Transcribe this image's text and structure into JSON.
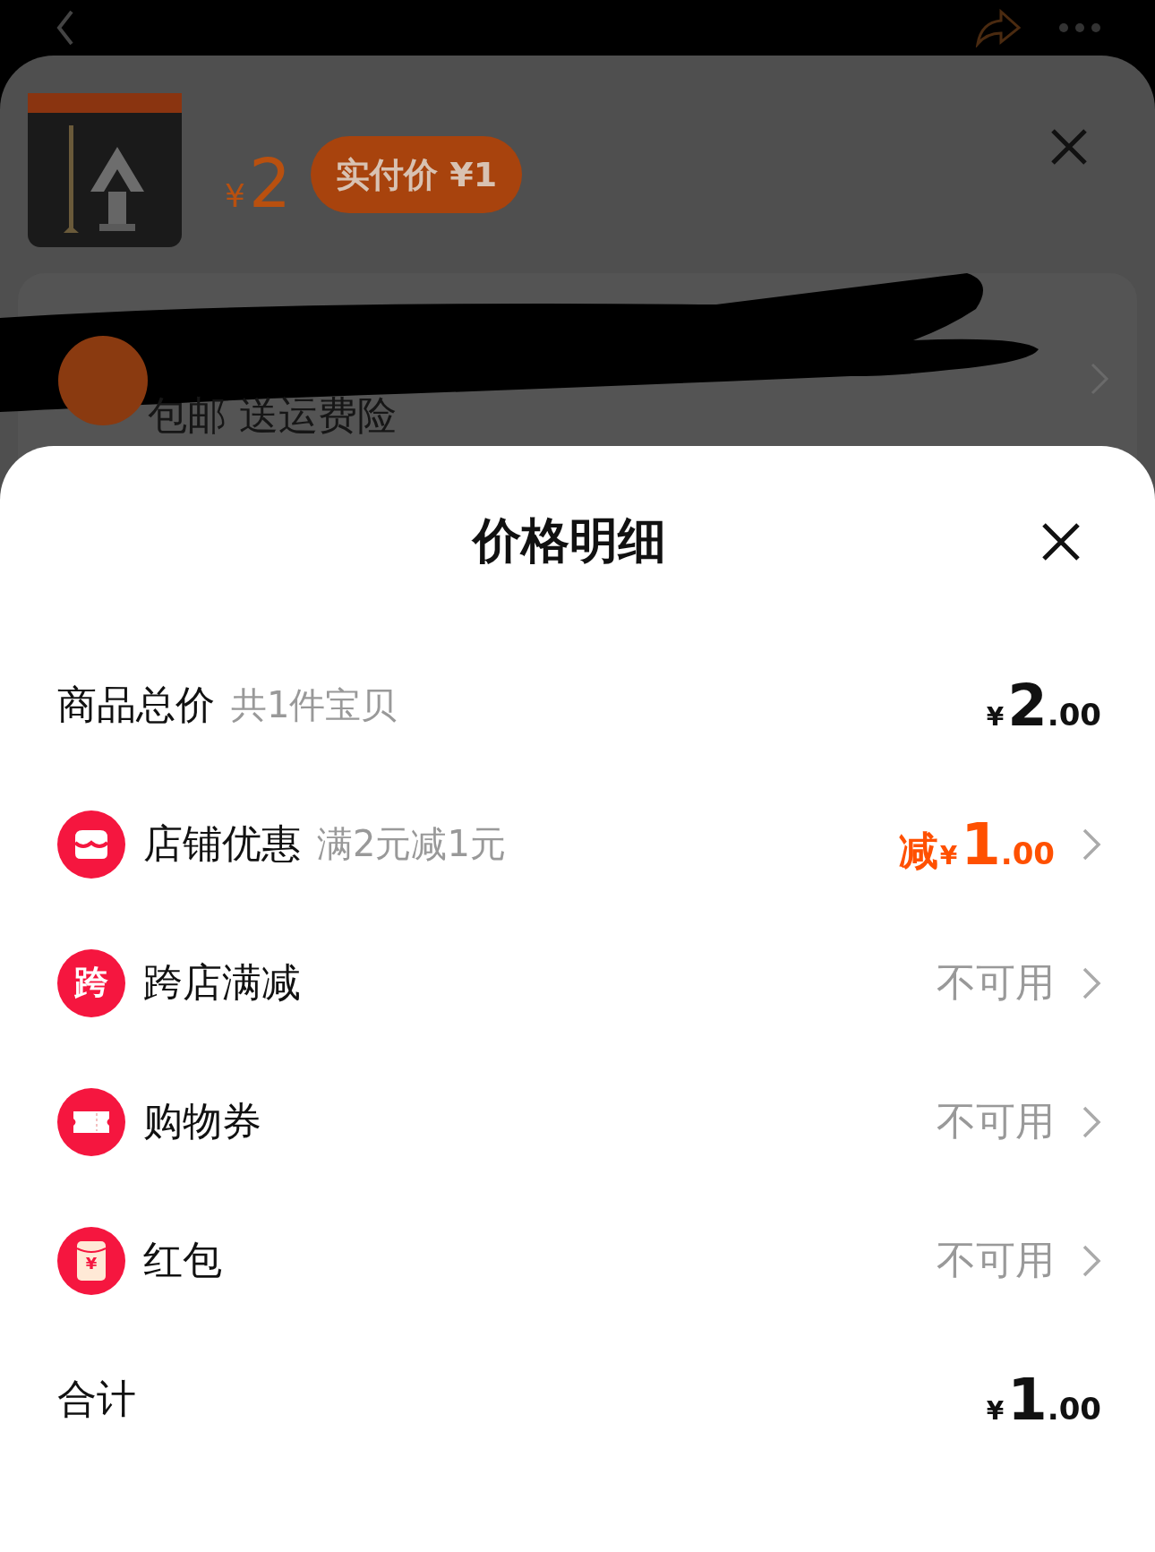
{
  "background": {
    "product": {
      "kind": "picture",
      "price_symbol": "¥",
      "price": "2",
      "pay_badge": "实付价 ¥1"
    },
    "shipping": "包邮 送运费险"
  },
  "sheet": {
    "title": "价格明细",
    "rows": [
      {
        "kind": "summary",
        "label": "商品总价",
        "note": "共1件宝贝",
        "amount": {
          "symbol": "¥",
          "integer": "2",
          "decimal": ".00"
        },
        "highlight": false
      },
      {
        "kind": "store",
        "label": "店铺优惠",
        "note": "满2元减1元",
        "amount": {
          "prefix": "减",
          "symbol": "¥",
          "integer": "1",
          "decimal": ".00"
        },
        "highlight": true
      },
      {
        "kind": "crossstore",
        "icon_text": "跨",
        "label": "跨店满减",
        "value": "不可用"
      },
      {
        "kind": "coupon",
        "label": "购物券",
        "value": "不可用"
      },
      {
        "kind": "envelope",
        "icon_text": "¥",
        "label": "红包",
        "value": "不可用"
      },
      {
        "kind": "summary",
        "label": "合计",
        "amount": {
          "symbol": "¥",
          "integer": "1",
          "decimal": ".00"
        },
        "highlight": false
      }
    ]
  }
}
